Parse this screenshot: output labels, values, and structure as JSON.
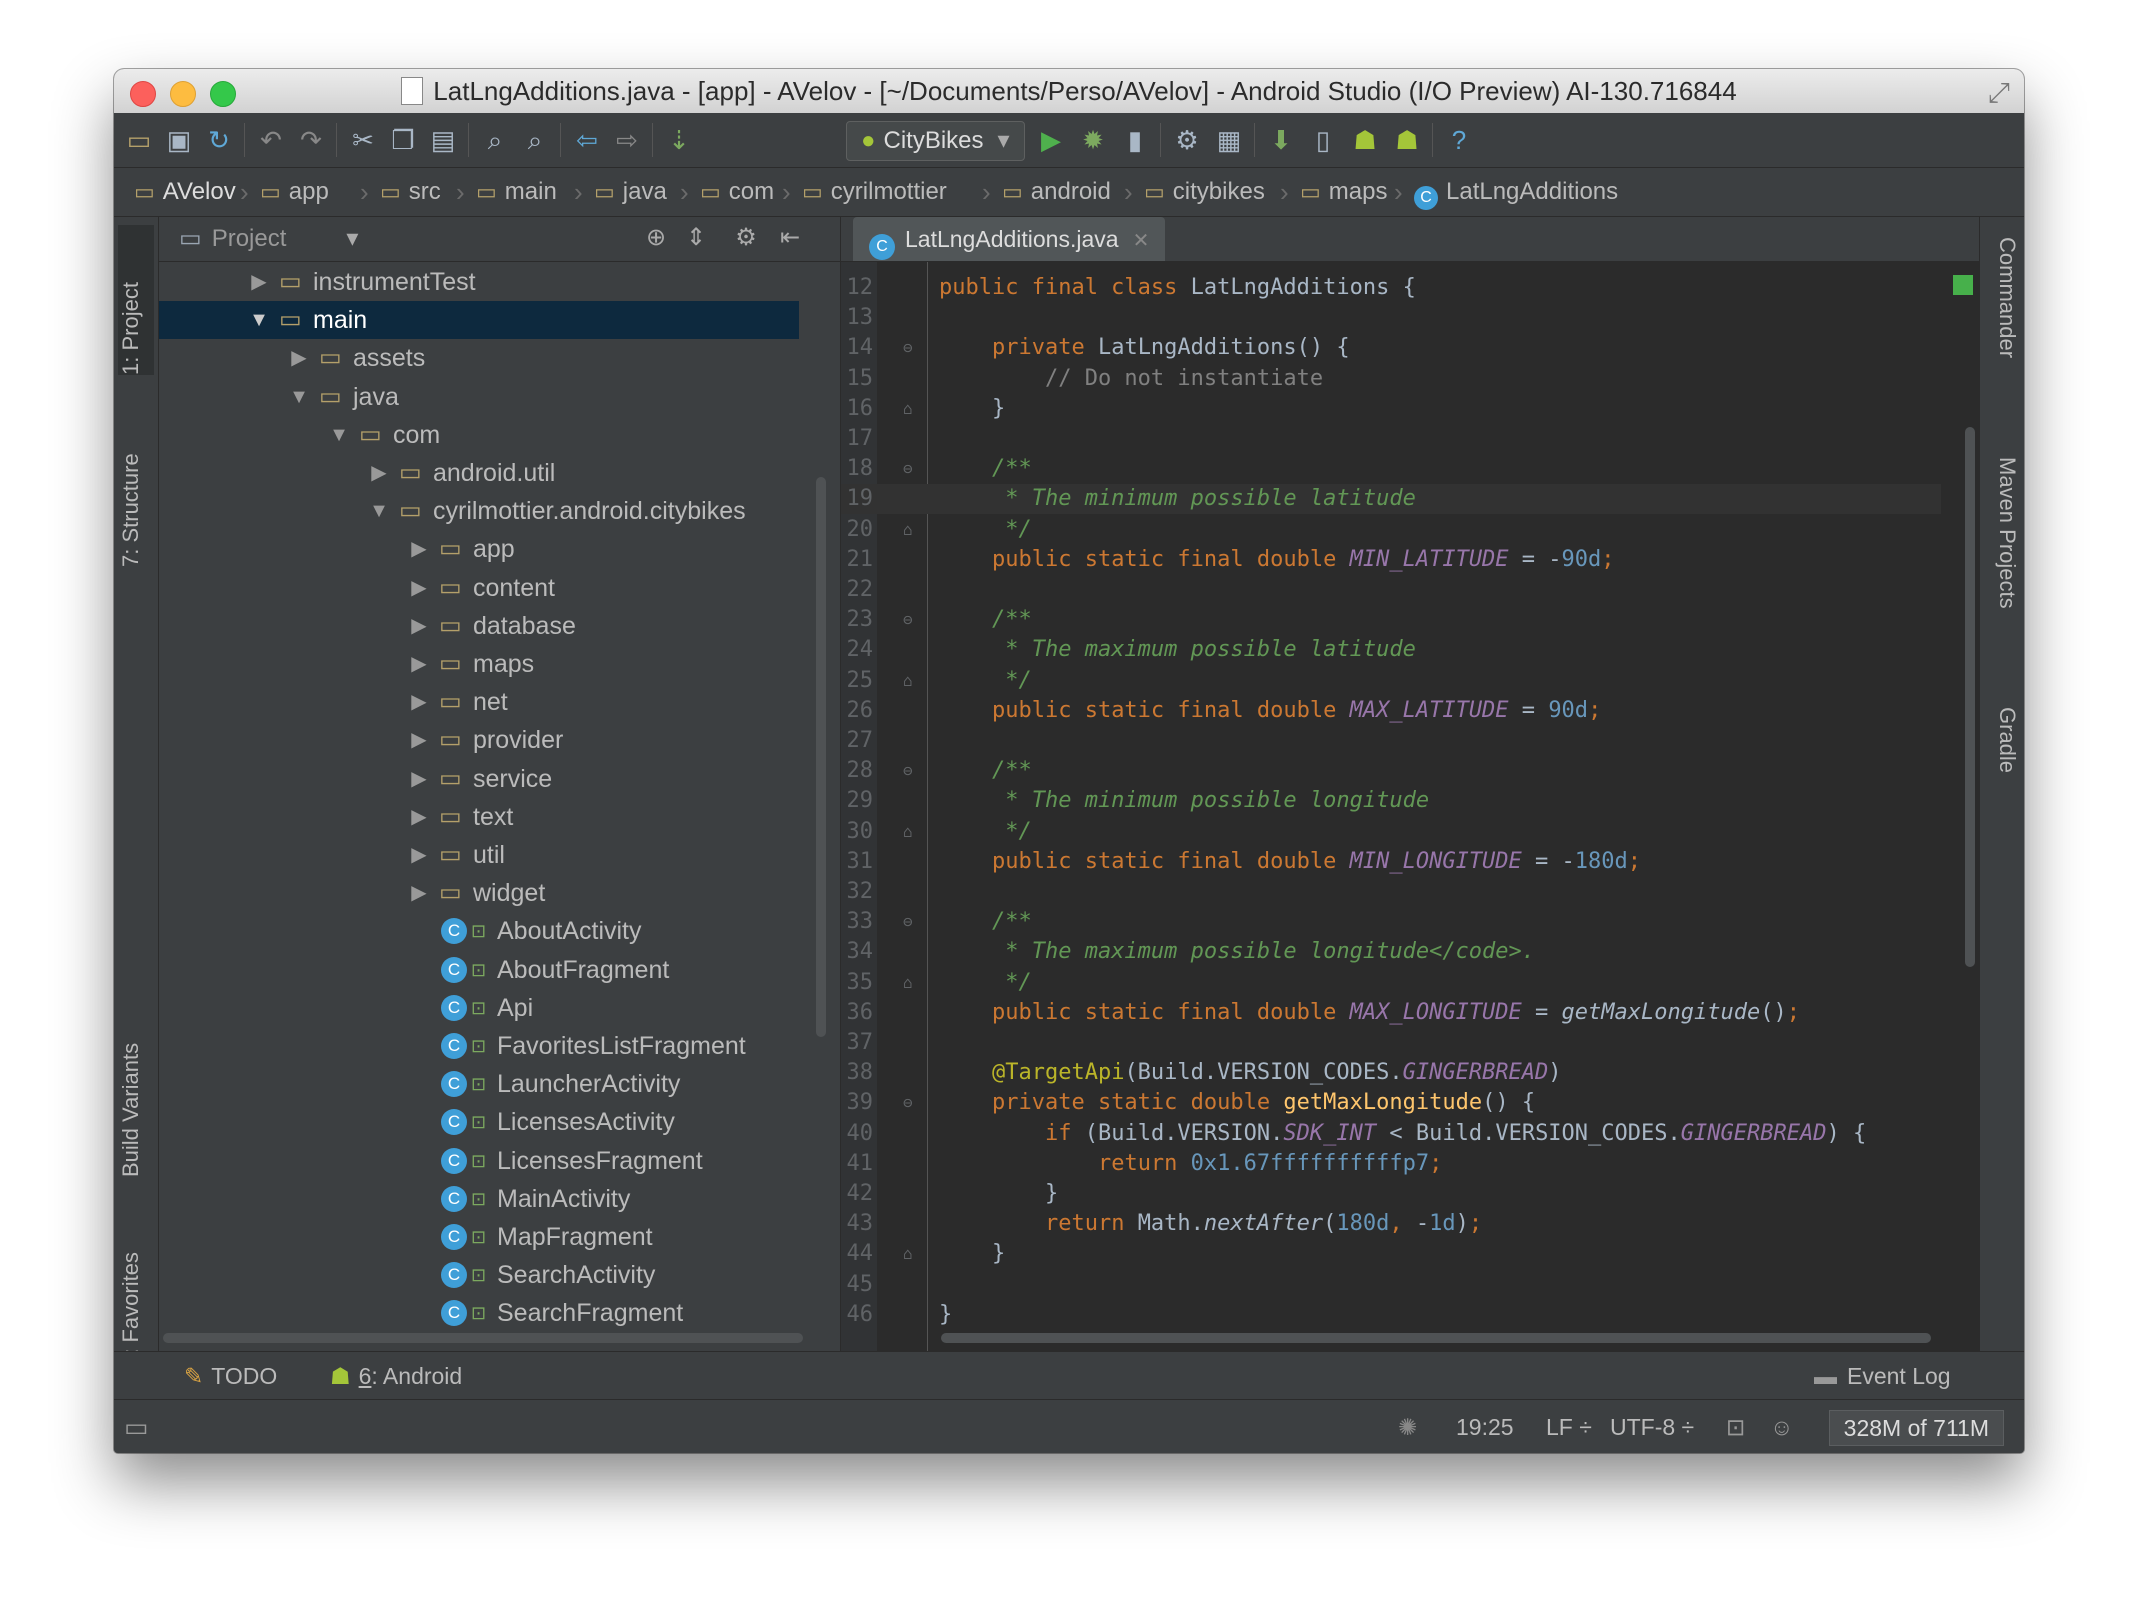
{
  "window": {
    "title": "LatLngAdditions.java - [app] - AVelov - [~/Documents/Perso/AVelov] - Android Studio (I/O Preview) AI-130.716844"
  },
  "toolbar": {
    "run_config": "CityBikes",
    "icons": [
      "open-folder-icon",
      "save-icon",
      "sync-icon",
      "undo-icon",
      "redo-icon",
      "cut-icon",
      "copy-icon",
      "paste-icon",
      "find-icon",
      "replace-icon",
      "back-icon",
      "forward-icon",
      "make-icon",
      "android-icon",
      "run-icon",
      "debug-icon",
      "attach-icon",
      "settings-icon",
      "project-structure-icon",
      "sdk-manager-icon",
      "avd-manager-icon",
      "monitor-icon",
      "android-device-icon",
      "help-icon"
    ]
  },
  "breadcrumbs": [
    "AVelov",
    "app",
    "src",
    "main",
    "java",
    "com",
    "cyrilmottier",
    "android",
    "citybikes",
    "maps",
    "LatLngAdditions"
  ],
  "left_tabs": {
    "project": "1: Project",
    "structure": "7: Structure",
    "build_variants": "Build Variants",
    "favorites": "2: Favorites"
  },
  "right_tabs": {
    "commander": "Commander",
    "maven": "Maven Projects",
    "gradle": "Gradle"
  },
  "project_panel": {
    "title": "Project",
    "tree": [
      {
        "label": "instrumentTest",
        "type": "folder",
        "depth": 0,
        "expanded": false
      },
      {
        "label": "main",
        "type": "folder",
        "depth": 0,
        "expanded": true,
        "selected": true
      },
      {
        "label": "assets",
        "type": "folder",
        "depth": 1,
        "expanded": false
      },
      {
        "label": "java",
        "type": "folder",
        "depth": 1,
        "expanded": true
      },
      {
        "label": "com",
        "type": "folder",
        "depth": 2,
        "expanded": true
      },
      {
        "label": "android.util",
        "type": "folder",
        "depth": 3,
        "expanded": false
      },
      {
        "label": "cyrilmottier.android.citybikes",
        "type": "folder",
        "depth": 3,
        "expanded": true
      },
      {
        "label": "app",
        "type": "folder",
        "depth": 4,
        "expanded": false
      },
      {
        "label": "content",
        "type": "folder",
        "depth": 4,
        "expanded": false
      },
      {
        "label": "database",
        "type": "folder",
        "depth": 4,
        "expanded": false
      },
      {
        "label": "maps",
        "type": "folder",
        "depth": 4,
        "expanded": false
      },
      {
        "label": "net",
        "type": "folder",
        "depth": 4,
        "expanded": false
      },
      {
        "label": "provider",
        "type": "folder",
        "depth": 4,
        "expanded": false
      },
      {
        "label": "service",
        "type": "folder",
        "depth": 4,
        "expanded": false
      },
      {
        "label": "text",
        "type": "folder",
        "depth": 4,
        "expanded": false
      },
      {
        "label": "util",
        "type": "folder",
        "depth": 4,
        "expanded": false
      },
      {
        "label": "widget",
        "type": "folder",
        "depth": 4,
        "expanded": false
      },
      {
        "label": "AboutActivity",
        "type": "class",
        "depth": 4
      },
      {
        "label": "AboutFragment",
        "type": "class",
        "depth": 4
      },
      {
        "label": "Api",
        "type": "class",
        "depth": 4
      },
      {
        "label": "FavoritesListFragment",
        "type": "class",
        "depth": 4
      },
      {
        "label": "LauncherActivity",
        "type": "class",
        "depth": 4
      },
      {
        "label": "LicensesActivity",
        "type": "class",
        "depth": 4
      },
      {
        "label": "LicensesFragment",
        "type": "class",
        "depth": 4
      },
      {
        "label": "MainActivity",
        "type": "class",
        "depth": 4
      },
      {
        "label": "MapFragment",
        "type": "class",
        "depth": 4
      },
      {
        "label": "SearchActivity",
        "type": "class",
        "depth": 4
      },
      {
        "label": "SearchFragment",
        "type": "class",
        "depth": 4
      }
    ]
  },
  "editor": {
    "tab": "LatLngAdditions.java",
    "current_line": 19,
    "lines": [
      {
        "n": 12,
        "tokens": [
          [
            "kw",
            "public final class "
          ],
          [
            "t",
            "LatLngAdditions {"
          ]
        ]
      },
      {
        "n": 13,
        "tokens": []
      },
      {
        "n": 14,
        "fold": "open",
        "tokens": [
          [
            "t",
            "    "
          ],
          [
            "kw",
            "private "
          ],
          [
            "t",
            "LatLngAdditions() {"
          ]
        ]
      },
      {
        "n": 15,
        "tokens": [
          [
            "cmd",
            "        // Do not instantiate"
          ]
        ]
      },
      {
        "n": 16,
        "fold": "close",
        "tokens": [
          [
            "t",
            "    }"
          ]
        ]
      },
      {
        "n": 17,
        "tokens": []
      },
      {
        "n": 18,
        "fold": "open",
        "tokens": [
          [
            "cm",
            "    /**"
          ]
        ]
      },
      {
        "n": 19,
        "tokens": [
          [
            "cm",
            "     * The minimum possible latitude"
          ]
        ]
      },
      {
        "n": 20,
        "fold": "close",
        "tokens": [
          [
            "cm",
            "     */"
          ]
        ]
      },
      {
        "n": 21,
        "tokens": [
          [
            "t",
            "    "
          ],
          [
            "kw",
            "public static final double "
          ],
          [
            "fld",
            "MIN_LATITUDE"
          ],
          [
            "t",
            " = -"
          ],
          [
            "num",
            "90d"
          ],
          [
            "kw",
            ";"
          ]
        ]
      },
      {
        "n": 22,
        "tokens": []
      },
      {
        "n": 23,
        "fold": "open",
        "tokens": [
          [
            "cm",
            "    /**"
          ]
        ]
      },
      {
        "n": 24,
        "tokens": [
          [
            "cm",
            "     * The maximum possible latitude"
          ]
        ]
      },
      {
        "n": 25,
        "fold": "close",
        "tokens": [
          [
            "cm",
            "     */"
          ]
        ]
      },
      {
        "n": 26,
        "tokens": [
          [
            "t",
            "    "
          ],
          [
            "kw",
            "public static final double "
          ],
          [
            "fld",
            "MAX_LATITUDE"
          ],
          [
            "t",
            " = "
          ],
          [
            "num",
            "90d"
          ],
          [
            "kw",
            ";"
          ]
        ]
      },
      {
        "n": 27,
        "tokens": []
      },
      {
        "n": 28,
        "fold": "open",
        "tokens": [
          [
            "cm",
            "    /**"
          ]
        ]
      },
      {
        "n": 29,
        "tokens": [
          [
            "cm",
            "     * The minimum possible longitude"
          ]
        ]
      },
      {
        "n": 30,
        "fold": "close",
        "tokens": [
          [
            "cm",
            "     */"
          ]
        ]
      },
      {
        "n": 31,
        "tokens": [
          [
            "t",
            "    "
          ],
          [
            "kw",
            "public static final double "
          ],
          [
            "fld",
            "MIN_LONGITUDE"
          ],
          [
            "t",
            " = -"
          ],
          [
            "num",
            "180d"
          ],
          [
            "kw",
            ";"
          ]
        ]
      },
      {
        "n": 32,
        "tokens": []
      },
      {
        "n": 33,
        "fold": "open",
        "tokens": [
          [
            "cm",
            "    /**"
          ]
        ]
      },
      {
        "n": 34,
        "tokens": [
          [
            "cm",
            "     * The maximum possible longitude</code>."
          ]
        ]
      },
      {
        "n": 35,
        "fold": "close",
        "tokens": [
          [
            "cm",
            "     */"
          ]
        ]
      },
      {
        "n": 36,
        "tokens": [
          [
            "t",
            "    "
          ],
          [
            "kw",
            "public static final double "
          ],
          [
            "fld",
            "MAX_LONGITUDE"
          ],
          [
            "t",
            " = "
          ],
          [
            "mth",
            "getMaxLongitude"
          ],
          [
            "t",
            "()"
          ],
          [
            "kw",
            ";"
          ]
        ]
      },
      {
        "n": 37,
        "tokens": []
      },
      {
        "n": 38,
        "tokens": [
          [
            "t",
            "    "
          ],
          [
            "ann",
            "@TargetApi"
          ],
          [
            "t",
            "(Build.VERSION_CODES."
          ],
          [
            "fld",
            "GINGERBREAD"
          ],
          [
            "t",
            ")"
          ]
        ]
      },
      {
        "n": 39,
        "fold": "open",
        "tokens": [
          [
            "t",
            "    "
          ],
          [
            "kw",
            "private static double "
          ],
          [
            "fn",
            "getMaxLongitude"
          ],
          [
            "t",
            "() {"
          ]
        ]
      },
      {
        "n": 40,
        "tokens": [
          [
            "t",
            "        "
          ],
          [
            "kw",
            "if "
          ],
          [
            "t",
            "(Build.VERSION."
          ],
          [
            "fld",
            "SDK_INT"
          ],
          [
            "t",
            " < Build.VERSION_CODES."
          ],
          [
            "fld",
            "GINGERBREAD"
          ],
          [
            "t",
            ") {"
          ]
        ]
      },
      {
        "n": 41,
        "tokens": [
          [
            "t",
            "            "
          ],
          [
            "kw",
            "return "
          ],
          [
            "num",
            "0x1.67ffffffffffp7"
          ],
          [
            "kw",
            ";"
          ]
        ]
      },
      {
        "n": 42,
        "tokens": [
          [
            "t",
            "        }"
          ]
        ]
      },
      {
        "n": 43,
        "tokens": [
          [
            "t",
            "        "
          ],
          [
            "kw",
            "return "
          ],
          [
            "t",
            "Math."
          ],
          [
            "mth",
            "nextAfter"
          ],
          [
            "t",
            "("
          ],
          [
            "num",
            "180d"
          ],
          [
            "kw",
            ", "
          ],
          [
            "t",
            "-"
          ],
          [
            "num",
            "1d"
          ],
          [
            "t",
            ")"
          ],
          [
            "kw",
            ";"
          ]
        ]
      },
      {
        "n": 44,
        "fold": "close",
        "tokens": [
          [
            "t",
            "    }"
          ]
        ]
      },
      {
        "n": 45,
        "tokens": []
      },
      {
        "n": 46,
        "tokens": [
          [
            "t",
            "}"
          ]
        ]
      }
    ]
  },
  "bottom_tools": {
    "todo": "TODO",
    "android_mnemonic": "6",
    "android": ": Android",
    "event_log": "Event Log"
  },
  "status": {
    "position": "19:25",
    "line_sep": "LF ÷",
    "encoding": "UTF-8 ÷",
    "memory": "328M of 711M"
  },
  "colors": {
    "bg": "#3c3f41",
    "editor_bg": "#2b2b2b",
    "keyword": "#cc7832",
    "comment": "#629755",
    "number": "#6897bb",
    "field": "#9876aa",
    "method_decl": "#ffc66d",
    "annotation": "#bbb529",
    "selection": "#0d293e"
  }
}
